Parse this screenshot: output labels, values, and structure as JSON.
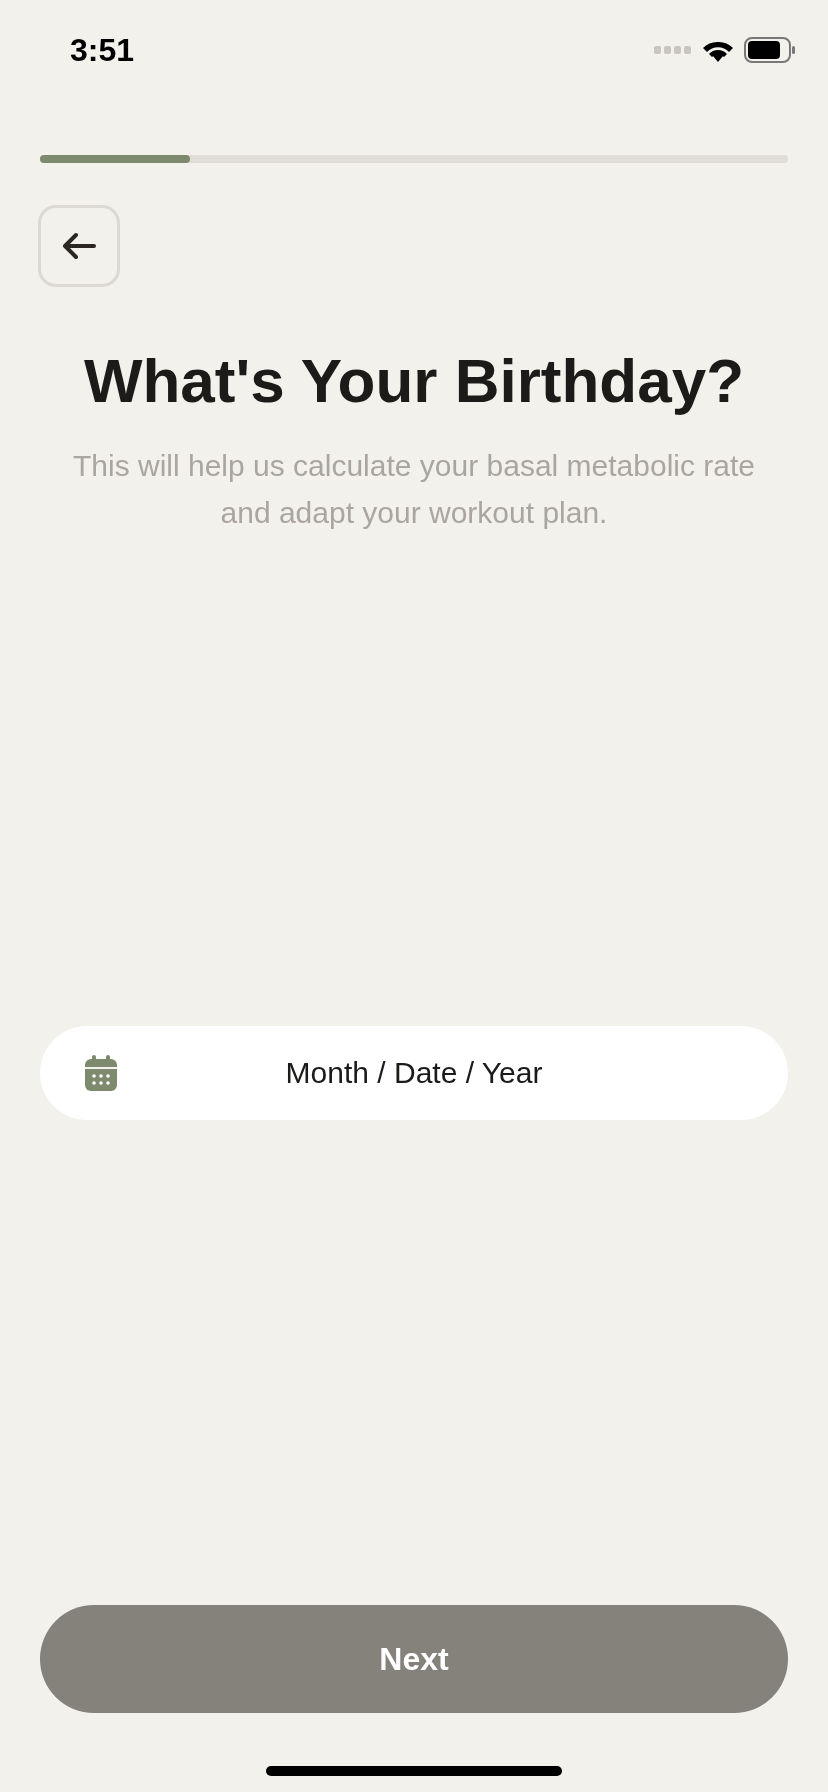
{
  "status_bar": {
    "time": "3:51"
  },
  "progress": {
    "level": 0.2
  },
  "title": "What's Your Birthday?",
  "subtitle": "This will help us calculate your basal metabolic rate and adapt your workout plan.",
  "date_field": {
    "placeholder": "Month / Date / Year"
  },
  "next_button": {
    "label": "Next",
    "disabled": true
  }
}
